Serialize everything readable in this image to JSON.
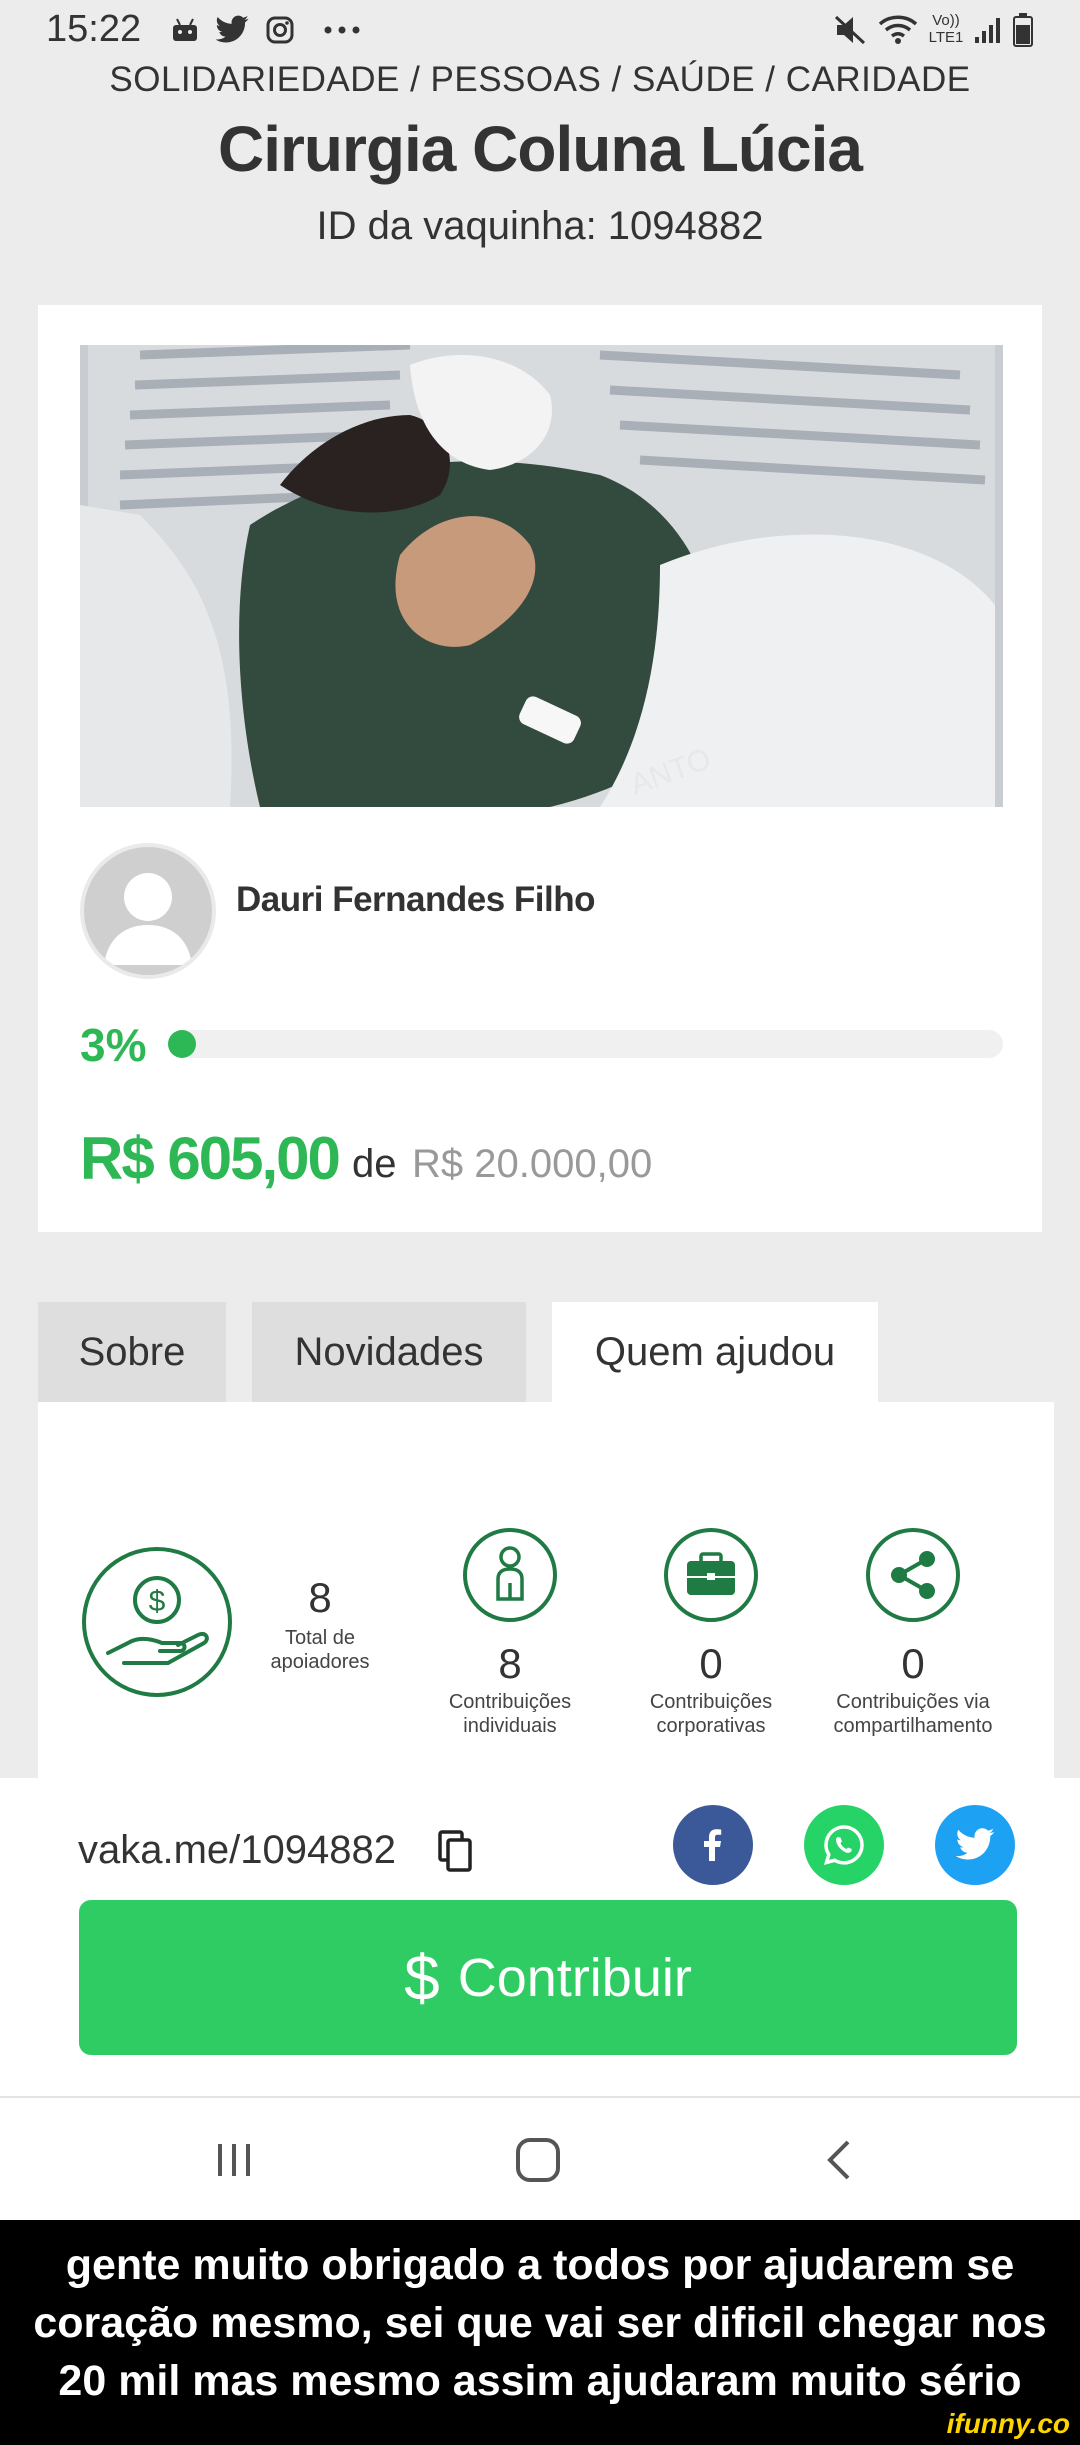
{
  "status_bar": {
    "time": "15:22",
    "left_icons": [
      "android-robot-icon",
      "twitter-icon",
      "instagram-icon",
      "more-dots-icon"
    ],
    "right_icons": [
      "mute-icon",
      "wifi-icon",
      "volte-icon",
      "signal-icon",
      "battery-icon"
    ],
    "volte_top": "Vo))",
    "volte_bottom": "LTE1"
  },
  "header": {
    "categories": "SOLIDARIEDADE / PESSOAS / SAÚDE / CARIDADE",
    "title": "Cirurgia Coluna Lúcia",
    "campaign_id": "ID da vaquinha: 1094882"
  },
  "campaign": {
    "photo_watermark_text": "ANTO",
    "author": "Dauri Fernandes Filho",
    "progress_percent_label": "3%",
    "progress_fraction": 0.03,
    "raised": "R$ 605,00",
    "of_label": "de",
    "goal": "R$ 20.000,00"
  },
  "tabs": [
    {
      "label": "Sobre",
      "active": false
    },
    {
      "label": "Novidades",
      "active": false
    },
    {
      "label": "Quem ajudou",
      "active": true
    }
  ],
  "supporters": {
    "total_value": "8",
    "total_label_1": "Total de",
    "total_label_2": "apoiadores",
    "stats": [
      {
        "icon": "person-icon",
        "value": "8",
        "label_1": "Contribuições",
        "label_2": "individuais"
      },
      {
        "icon": "briefcase-icon",
        "value": "0",
        "label_1": "Contribuições",
        "label_2": "corporativas"
      },
      {
        "icon": "share-icon",
        "value": "0",
        "label_1": "Contribuições via",
        "label_2": "compartilhamento"
      }
    ]
  },
  "share": {
    "short_url": "vaka.me/1094882",
    "contribute_symbol": "$",
    "contribute_label": "Contribuir"
  },
  "colors": {
    "accent_green": "#2eb855",
    "button_green": "#2ecc62",
    "facebook_blue": "#3b5998",
    "whatsapp_green": "#25d366",
    "twitter_blue": "#1da1f2",
    "icon_green": "#1f7a43"
  },
  "caption": {
    "text": "gente muito obrigado a todos por ajudarem se coração mesmo, sei que vai ser dificil chegar nos 20 mil mas mesmo assim ajudaram muito sério",
    "watermark": "ifunny.co"
  }
}
